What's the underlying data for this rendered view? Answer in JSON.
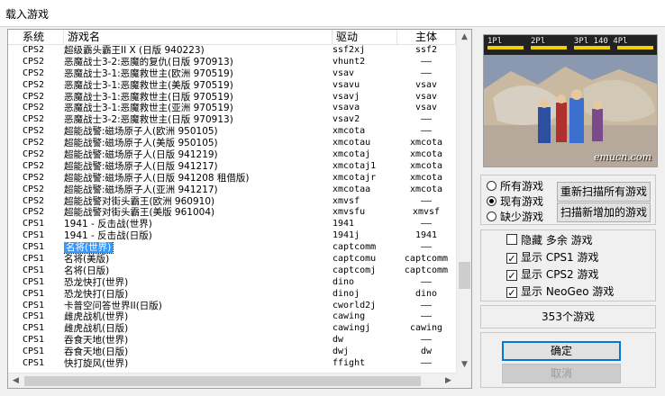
{
  "window": {
    "title": "载入游戏"
  },
  "list": {
    "columns": {
      "system": "系统",
      "name": "游戏名",
      "driver": "驱动",
      "parent": "主体"
    },
    "rows": [
      {
        "system": "CPS2",
        "name": "超级霸头霸王II X (日版 940223)",
        "driver": "ssf2xj",
        "parent": "ssf2"
      },
      {
        "system": "CPS2",
        "name": "恶魔战士3-2:恶魔的复仇(日版 970913)",
        "driver": "vhunt2",
        "parent": "——"
      },
      {
        "system": "CPS2",
        "name": "恶魔战士3-1:恶魔救世主(欧洲 970519)",
        "driver": "vsav",
        "parent": "——"
      },
      {
        "system": "CPS2",
        "name": "恶魔战士3-1:恶魔救世主(美版 970519)",
        "driver": "vsavu",
        "parent": "vsav"
      },
      {
        "system": "CPS2",
        "name": "恶魔战士3-1:恶魔救世主(日版 970519)",
        "driver": "vsavj",
        "parent": "vsav"
      },
      {
        "system": "CPS2",
        "name": "恶魔战士3-1:恶魔救世主(亚洲 970519)",
        "driver": "vsava",
        "parent": "vsav"
      },
      {
        "system": "CPS2",
        "name": "恶魔战士3-2:恶魔救世主(日版 970913)",
        "driver": "vsav2",
        "parent": "——"
      },
      {
        "system": "CPS2",
        "name": "超能战警:磁场原子人(欧洲 950105)",
        "driver": "xmcota",
        "parent": "——"
      },
      {
        "system": "CPS2",
        "name": "超能战警:磁场原子人(美版 950105)",
        "driver": "xmcotau",
        "parent": "xmcota"
      },
      {
        "system": "CPS2",
        "name": "超能战警:磁场原子人(日版 941219)",
        "driver": "xmcotaj",
        "parent": "xmcota"
      },
      {
        "system": "CPS2",
        "name": "超能战警:磁场原子人(日版 941217)",
        "driver": "xmcotaj1",
        "parent": "xmcota"
      },
      {
        "system": "CPS2",
        "name": "超能战警:磁场原子人(日版 941208 租借版)",
        "driver": "xmcotajr",
        "parent": "xmcota"
      },
      {
        "system": "CPS2",
        "name": "超能战警:磁场原子人(亚洲 941217)",
        "driver": "xmcotaa",
        "parent": "xmcota"
      },
      {
        "system": "CPS2",
        "name": "超能战警对街头霸王(欧洲 960910)",
        "driver": "xmvsf",
        "parent": "——"
      },
      {
        "system": "CPS2",
        "name": "超能战警对街头霸王(美版 961004)",
        "driver": "xmvsfu",
        "parent": "xmvsf"
      },
      {
        "system": "CPS1",
        "name": "1941 - 反击战(世界)",
        "driver": "1941",
        "parent": "——"
      },
      {
        "system": "CPS1",
        "name": "1941 - 反击战(日版)",
        "driver": "1941j",
        "parent": "1941"
      },
      {
        "system": "CPS1",
        "name": "名将(世界)",
        "driver": "captcomm",
        "parent": "——",
        "selected": true
      },
      {
        "system": "CPS1",
        "name": "名将(美版)",
        "driver": "captcomu",
        "parent": "captcomm"
      },
      {
        "system": "CPS1",
        "name": "名将(日版)",
        "driver": "captcomj",
        "parent": "captcomm"
      },
      {
        "system": "CPS1",
        "name": "恐龙快打(世界)",
        "driver": "dino",
        "parent": "——"
      },
      {
        "system": "CPS1",
        "name": "恐龙快打(日版)",
        "driver": "dinoj",
        "parent": "dino"
      },
      {
        "system": "CPS1",
        "name": "卡普空问答世界II(日版)",
        "driver": "cworld2j",
        "parent": "——"
      },
      {
        "system": "CPS1",
        "name": "雌虎战机(世界)",
        "driver": "cawing",
        "parent": "——"
      },
      {
        "system": "CPS1",
        "name": "雌虎战机(日版)",
        "driver": "cawingj",
        "parent": "cawing"
      },
      {
        "system": "CPS1",
        "name": "吞食天地(世界)",
        "driver": "dw",
        "parent": "——"
      },
      {
        "system": "CPS1",
        "name": "吞食天地(日版)",
        "driver": "dwj",
        "parent": "dw"
      },
      {
        "system": "CPS1",
        "name": "快打旋风(世界)",
        "driver": "ffight",
        "parent": "——"
      }
    ]
  },
  "preview": {
    "hud_left": "1Pl",
    "hud_mid": "2Pl",
    "hud_right": "3Pl 140 4Pl",
    "watermark": "emucn.com"
  },
  "filter": {
    "all_label": "所有游戏",
    "available_label": "现有游戏",
    "missing_label": "缺少游戏",
    "selected": "available"
  },
  "buttons": {
    "rescan_all": "重新扫描所有游戏",
    "scan_new": "扫描新增加的游戏",
    "ok": "确定",
    "cancel": "取消"
  },
  "options": {
    "hide_extra": {
      "label": "隐藏 多余 游戏",
      "checked": false
    },
    "show_cps1": {
      "label": "显示 CPS1 游戏",
      "checked": true
    },
    "show_cps2": {
      "label": "显示 CPS2 游戏",
      "checked": true
    },
    "show_neogeo": {
      "label": "显示 NeoGeo 游戏",
      "checked": true
    }
  },
  "count_text": "353个游戏"
}
